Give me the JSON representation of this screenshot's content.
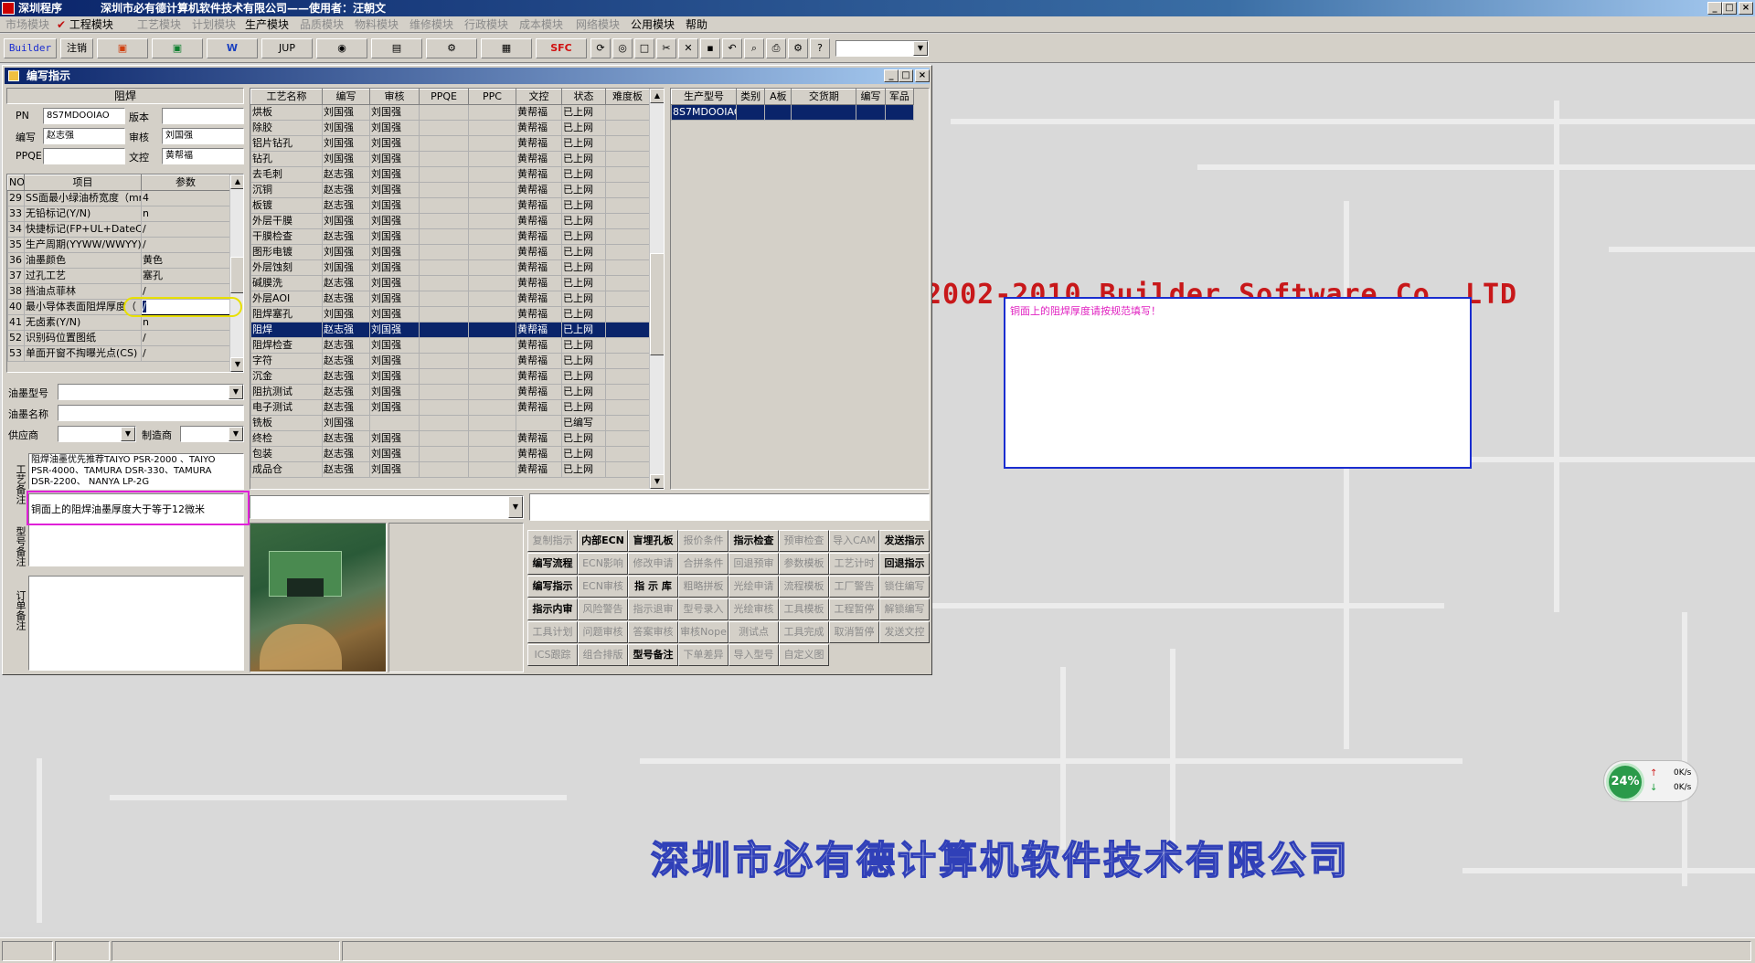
{
  "app": {
    "title": "深圳程序",
    "subtitle": "深圳市必有德计算机软件技术有限公司——使用者：汪朝文"
  },
  "menu": [
    {
      "label": "市场模块",
      "active": false
    },
    {
      "label": "工程模块",
      "active": true,
      "checked": true
    },
    {
      "label": "工艺模块",
      "active": false
    },
    {
      "label": "计划模块",
      "active": false
    },
    {
      "label": "生产模块",
      "active": true
    },
    {
      "label": "品质模块",
      "active": false
    },
    {
      "label": "物料模块",
      "active": false
    },
    {
      "label": "维修模块",
      "active": false
    },
    {
      "label": "行政模块",
      "active": false
    },
    {
      "label": "成本模块",
      "active": false
    },
    {
      "label": "网络模块",
      "active": false
    },
    {
      "label": "公用模块",
      "active": true
    },
    {
      "label": "帮助",
      "active": true
    }
  ],
  "toolbar": {
    "builder": "Builder",
    "logout": "注销",
    "jup": "JUP",
    "spc": "SFC"
  },
  "child": {
    "title": "编写指示"
  },
  "header_form": {
    "section": "阻焊",
    "pn_label": "PN",
    "pn_value": "8S7MDOOIAO",
    "version_label": "版本",
    "version_value": "",
    "writer_label": "编写",
    "writer_value": "赵志强",
    "reviewer_label": "审核",
    "reviewer_value": "刘国强",
    "ppqe_label": "PPQE",
    "ppqe_value": "",
    "dc_label": "文控",
    "dc_value": "黄帮福"
  },
  "params": {
    "headers": [
      "NO",
      "项目",
      "参数"
    ],
    "rows": [
      [
        "29",
        "SS面最小绿油桥宽度（mm）",
        "4"
      ],
      [
        "33",
        "无铅标记(Y/N)",
        "n"
      ],
      [
        "34",
        "快捷标记(FP+UL+DateCode)",
        "/"
      ],
      [
        "35",
        "生产周期(YYWW/WWYY)",
        "/"
      ],
      [
        "36",
        "油墨颜色",
        "黄色"
      ],
      [
        "37",
        "过孔工艺",
        "塞孔"
      ],
      [
        "38",
        "挡油点菲林",
        "/"
      ],
      [
        "40",
        "最小导体表面阻焊厚度（",
        ""
      ],
      [
        "41",
        "无卤素(Y/N)",
        "n"
      ],
      [
        "52",
        "识别码位置图纸",
        "/"
      ],
      [
        "53",
        "单面开窗不掏曝光点(CS)",
        "/"
      ]
    ],
    "edit_value": "/"
  },
  "ink": {
    "model_label": "油墨型号",
    "name_label": "油墨名称",
    "supplier_label": "供应商",
    "maker_label": "制造商"
  },
  "notes": {
    "process_label": "工艺备注",
    "process_text": "阻焊油墨优先推荐TAIYO PSR-2000 、TAIYO PSR-4000、TAMURA DSR-330、TAMURA DSR-2200、 NANYA LP-2G",
    "model_label": "型号备注",
    "model_text": "铜面上的阻焊油墨厚度大于等于12微米",
    "order_label": "订单备注"
  },
  "process": {
    "headers": [
      "工艺名称",
      "编写",
      "审核",
      "PPQE",
      "PPC",
      "文控",
      "状态",
      "难度板"
    ],
    "rows": [
      [
        "烘板",
        "刘国强",
        "刘国强",
        "",
        "",
        "黄帮福",
        "已上网",
        ""
      ],
      [
        "除胶",
        "刘国强",
        "刘国强",
        "",
        "",
        "黄帮福",
        "已上网",
        ""
      ],
      [
        "铝片钻孔",
        "刘国强",
        "刘国强",
        "",
        "",
        "黄帮福",
        "已上网",
        ""
      ],
      [
        "钻孔",
        "刘国强",
        "刘国强",
        "",
        "",
        "黄帮福",
        "已上网",
        ""
      ],
      [
        "去毛刺",
        "赵志强",
        "刘国强",
        "",
        "",
        "黄帮福",
        "已上网",
        ""
      ],
      [
        "沉铜",
        "赵志强",
        "刘国强",
        "",
        "",
        "黄帮福",
        "已上网",
        ""
      ],
      [
        "板镀",
        "赵志强",
        "刘国强",
        "",
        "",
        "黄帮福",
        "已上网",
        ""
      ],
      [
        "外层干膜",
        "刘国强",
        "刘国强",
        "",
        "",
        "黄帮福",
        "已上网",
        ""
      ],
      [
        "干膜检查",
        "赵志强",
        "刘国强",
        "",
        "",
        "黄帮福",
        "已上网",
        ""
      ],
      [
        "图形电镀",
        "刘国强",
        "刘国强",
        "",
        "",
        "黄帮福",
        "已上网",
        ""
      ],
      [
        "外层蚀刻",
        "刘国强",
        "刘国强",
        "",
        "",
        "黄帮福",
        "已上网",
        ""
      ],
      [
        "碱膜洗",
        "赵志强",
        "刘国强",
        "",
        "",
        "黄帮福",
        "已上网",
        ""
      ],
      [
        "外层AOI",
        "赵志强",
        "刘国强",
        "",
        "",
        "黄帮福",
        "已上网",
        ""
      ],
      [
        "阻焊塞孔",
        "刘国强",
        "刘国强",
        "",
        "",
        "黄帮福",
        "已上网",
        ""
      ],
      [
        "阻焊",
        "赵志强",
        "刘国强",
        "",
        "",
        "黄帮福",
        "已上网",
        ""
      ],
      [
        "阻焊检查",
        "赵志强",
        "刘国强",
        "",
        "",
        "黄帮福",
        "已上网",
        ""
      ],
      [
        "字符",
        "赵志强",
        "刘国强",
        "",
        "",
        "黄帮福",
        "已上网",
        ""
      ],
      [
        "沉金",
        "赵志强",
        "刘国强",
        "",
        "",
        "黄帮福",
        "已上网",
        ""
      ],
      [
        "阻抗测试",
        "赵志强",
        "刘国强",
        "",
        "",
        "黄帮福",
        "已上网",
        ""
      ],
      [
        "电子测试",
        "赵志强",
        "刘国强",
        "",
        "",
        "黄帮福",
        "已上网",
        ""
      ],
      [
        "铣板",
        "刘国强",
        "",
        "",
        "",
        "",
        "已编写",
        ""
      ],
      [
        "终检",
        "赵志强",
        "刘国强",
        "",
        "",
        "黄帮福",
        "已上网",
        ""
      ],
      [
        "包装",
        "赵志强",
        "刘国强",
        "",
        "",
        "黄帮福",
        "已上网",
        ""
      ],
      [
        "成品仓",
        "赵志强",
        "刘国强",
        "",
        "",
        "黄帮福",
        "已上网",
        ""
      ]
    ],
    "selected_index": 14
  },
  "orders": {
    "headers": [
      "生产型号",
      "类别",
      "A板",
      "交货期",
      "编写",
      "军品"
    ],
    "rows": [
      [
        "8S7MDOOIAO",
        "",
        "",
        "",
        "",
        ""
      ]
    ]
  },
  "actions": [
    {
      "label": "复制指示",
      "on": false
    },
    {
      "label": "内部ECN",
      "on": true
    },
    {
      "label": "盲埋孔板",
      "on": true
    },
    {
      "label": "报价条件",
      "on": false
    },
    {
      "label": "指示检查",
      "on": true
    },
    {
      "label": "预审检查",
      "on": false
    },
    {
      "label": "导入CAM",
      "on": false
    },
    {
      "label": "发送指示",
      "on": true
    },
    {
      "label": "编写流程",
      "on": true
    },
    {
      "label": "ECN影响",
      "on": false
    },
    {
      "label": "修改申请",
      "on": false
    },
    {
      "label": "合拼条件",
      "on": false
    },
    {
      "label": "回退预审",
      "on": false
    },
    {
      "label": "参数模板",
      "on": false
    },
    {
      "label": "工艺计时",
      "on": false
    },
    {
      "label": "回退指示",
      "on": true
    },
    {
      "label": "编写指示",
      "on": true
    },
    {
      "label": "ECN审核",
      "on": false
    },
    {
      "label": "指 示 库",
      "on": true
    },
    {
      "label": "粗略拼板",
      "on": false
    },
    {
      "label": "光绘申请",
      "on": false
    },
    {
      "label": "流程模板",
      "on": false
    },
    {
      "label": "工厂警告",
      "on": false
    },
    {
      "label": "锁住编写",
      "on": false
    },
    {
      "label": "指示内审",
      "on": true
    },
    {
      "label": "风险警告",
      "on": false
    },
    {
      "label": "指示退审",
      "on": false
    },
    {
      "label": "型号录入",
      "on": false
    },
    {
      "label": "光绘审核",
      "on": false
    },
    {
      "label": "工具模板",
      "on": false
    },
    {
      "label": "工程暂停",
      "on": false
    },
    {
      "label": "解锁编写",
      "on": false
    },
    {
      "label": "工具计划",
      "on": false
    },
    {
      "label": "问题审核",
      "on": false
    },
    {
      "label": "答案审核",
      "on": false
    },
    {
      "label": "审核Nope",
      "on": false
    },
    {
      "label": "测试点",
      "on": false
    },
    {
      "label": "工具完成",
      "on": false
    },
    {
      "label": "取消暂停",
      "on": false
    },
    {
      "label": "发送文控",
      "on": false
    },
    {
      "label": "ICS跟踪",
      "on": false
    },
    {
      "label": "组合排版",
      "on": false
    },
    {
      "label": "型号备注",
      "on": true
    },
    {
      "label": "下单差异",
      "on": false
    },
    {
      "label": "导入型号",
      "on": false
    },
    {
      "label": "自定义图",
      "on": false
    }
  ],
  "message": {
    "text": "铜面上的阻焊厚度请按规范填写！"
  },
  "desktop": {
    "copyright": "2002-2010 Builder Software Co.,LTD",
    "company": "深圳市必有德计算机软件技术有限公司"
  },
  "netmon": {
    "percent": "24%",
    "up": "0K/s",
    "down": "0K/s"
  },
  "colors": {
    "accent": "#0a246a",
    "copyright": "#c8181a",
    "company": "#3040b8",
    "highlight_yellow": "#e8e000",
    "highlight_magenta": "#e020d8"
  }
}
